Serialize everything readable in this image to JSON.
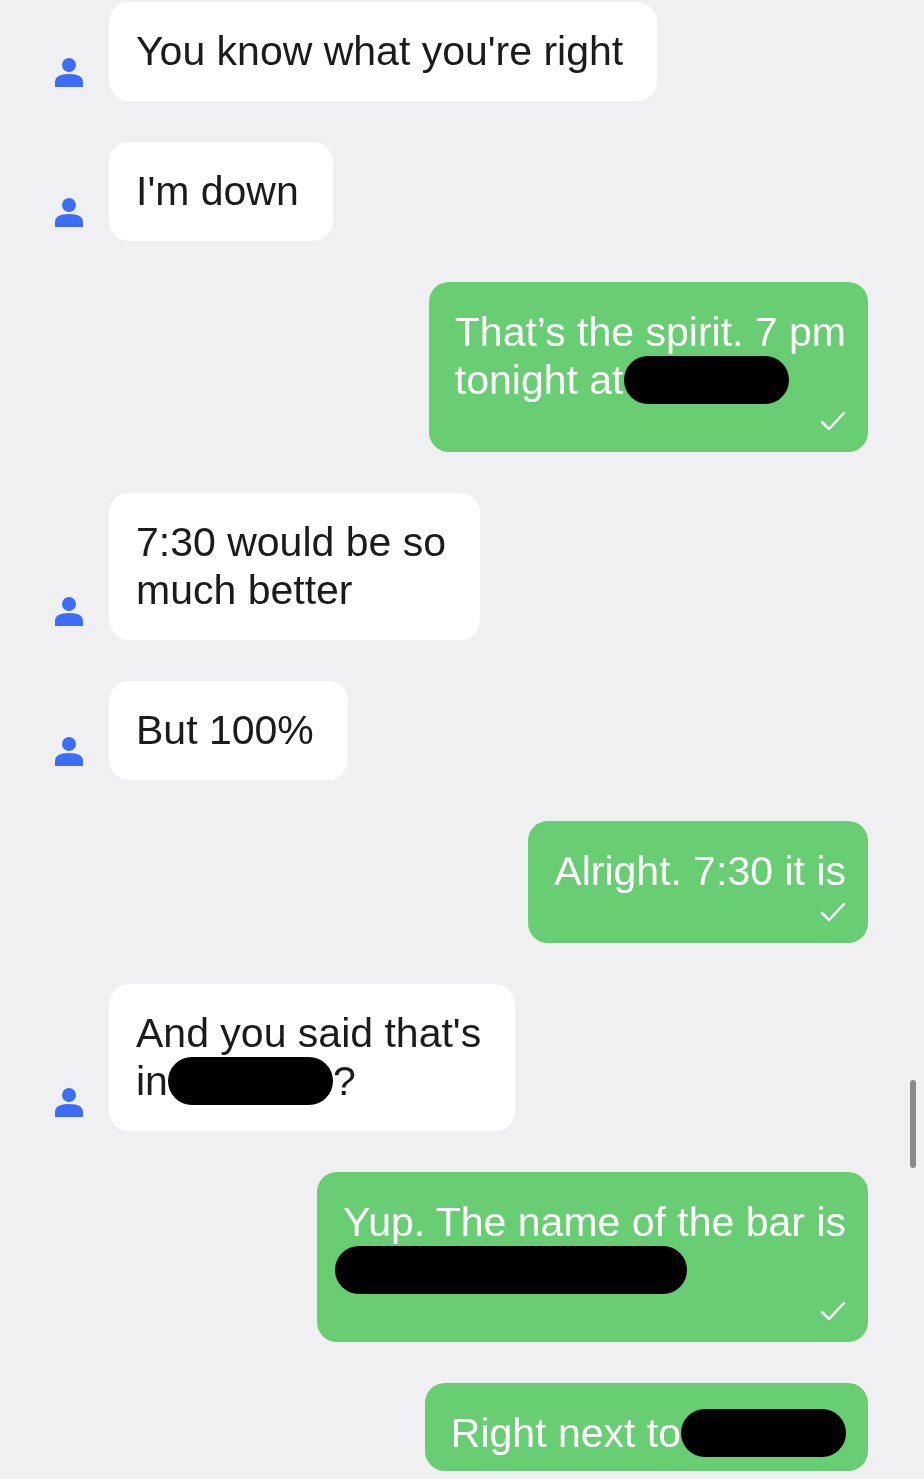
{
  "messages": [
    {
      "outgoing": false,
      "lines": [
        [
          {
            "kind": "text",
            "text": "You know what you're right"
          }
        ]
      ]
    },
    {
      "outgoing": false,
      "lines": [
        [
          {
            "kind": "text",
            "text": "I'm down"
          }
        ]
      ]
    },
    {
      "outgoing": true,
      "delivered": true,
      "lines": [
        [
          {
            "kind": "text",
            "text": "That’s the spirit. 7 pm"
          }
        ],
        [
          {
            "kind": "text",
            "text": "tonight at"
          },
          {
            "kind": "redaction",
            "wide": false
          }
        ]
      ]
    },
    {
      "outgoing": false,
      "lines": [
        [
          {
            "kind": "text",
            "text": "7:30 would be so"
          }
        ],
        [
          {
            "kind": "text",
            "text": "much better"
          }
        ]
      ]
    },
    {
      "outgoing": false,
      "lines": [
        [
          {
            "kind": "text",
            "text": "But 100%"
          }
        ]
      ]
    },
    {
      "outgoing": true,
      "delivered": true,
      "lines": [
        [
          {
            "kind": "text",
            "text": "Alright. 7:30 it is"
          }
        ]
      ]
    },
    {
      "outgoing": false,
      "lines": [
        [
          {
            "kind": "text",
            "text": "And you said that's"
          }
        ],
        [
          {
            "kind": "text",
            "text": "in"
          },
          {
            "kind": "redaction",
            "wide": false
          },
          {
            "kind": "text",
            "text": "?"
          }
        ]
      ]
    },
    {
      "outgoing": true,
      "delivered": true,
      "lines": [
        [
          {
            "kind": "text",
            "text": "Yup. The name of the bar is"
          }
        ],
        [
          {
            "kind": "redaction",
            "wide": true
          }
        ]
      ]
    },
    {
      "outgoing": true,
      "lines": [
        [
          {
            "kind": "text",
            "text": "Right next to"
          },
          {
            "kind": "redaction",
            "wide": false
          }
        ]
      ]
    }
  ]
}
